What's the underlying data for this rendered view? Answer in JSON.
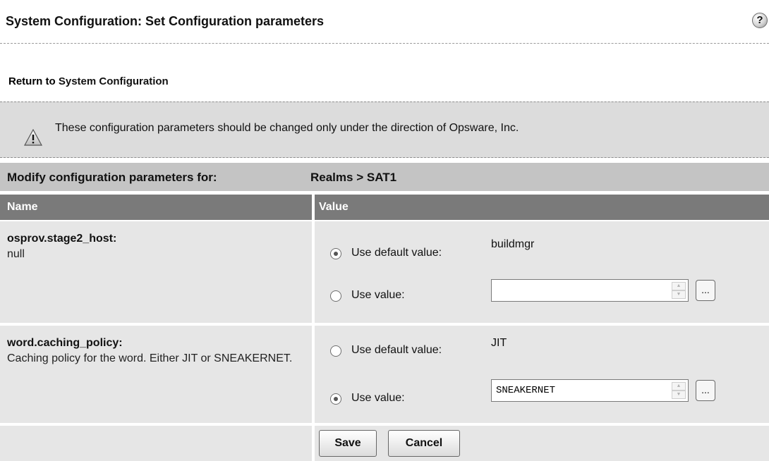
{
  "header": {
    "title": "System Configuration: Set Configuration parameters",
    "help_glyph": "?",
    "help_icon": "help-icon"
  },
  "return": {
    "prefix": "Return to",
    "link_text": "System Configuration"
  },
  "warning": {
    "icon": "warning-icon",
    "text": "These configuration parameters should be changed only under the direction of Opsware, Inc."
  },
  "modify": {
    "label": "Modify configuration parameters for:",
    "path": "Realms > SAT1"
  },
  "table": {
    "columns": [
      "Name",
      "Value"
    ],
    "rows": [
      {
        "name": "osprov.stage2_host:",
        "description": "null",
        "default_label": "Use default value:",
        "default_value": "buildmgr",
        "use_value_label": "Use value:",
        "input_value": "",
        "selected": "default"
      },
      {
        "name": "word.caching_policy:",
        "description": "Caching policy for the word. Either JIT or SNEAKERNET.",
        "default_label": "Use default value:",
        "default_value": "JIT",
        "use_value_label": "Use value:",
        "input_value": "SNEAKERNET",
        "selected": "value"
      }
    ]
  },
  "buttons": {
    "save": "Save",
    "cancel": "Cancel",
    "browse": "..."
  },
  "colors": {
    "header_bar": "#7a7a7a",
    "modify_bar": "#c4c4c4",
    "row_bg": "#e6e6e6",
    "warning_bg": "#dcdcdc"
  }
}
